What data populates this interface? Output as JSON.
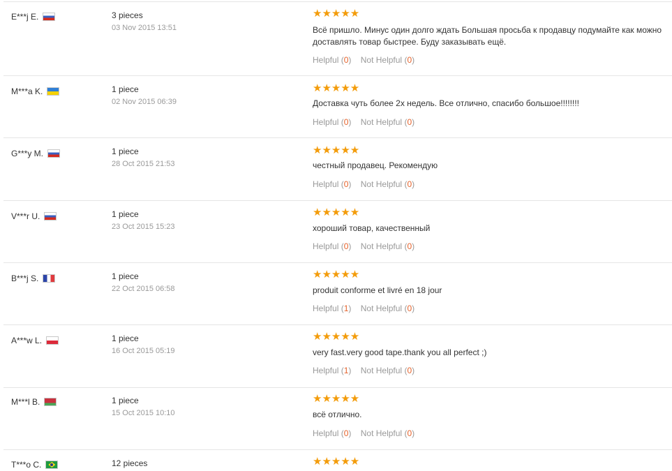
{
  "colors": {
    "star": "#f39c0b",
    "vote_count": "#e5622a",
    "meta": "#999999",
    "separator": "#e5e5e5"
  },
  "labels": {
    "helpful": "Helpful",
    "not_helpful": "Not Helpful"
  },
  "reviews": [
    {
      "buyer": "E***j E.",
      "flag": "russia-flag",
      "quantity": "3 pieces",
      "date": "03 Nov 2015 13:51",
      "rating": 5,
      "stars": "★★★★★",
      "comment": "Всё пришло. Минус один долго ждать Большая просьба к продавцу подумайте как можно доставлять товар быстрее. Буду заказывать ещё.",
      "helpful": "0",
      "not_helpful": "0"
    },
    {
      "buyer": "M***a K.",
      "flag": "ukraine-flag",
      "quantity": "1 piece",
      "date": "02 Nov 2015 06:39",
      "rating": 5,
      "stars": "★★★★★",
      "comment": "Доставка чуть более 2х недель. Все отлично, спасибо большое!!!!!!!!",
      "helpful": "0",
      "not_helpful": "0"
    },
    {
      "buyer": "G***y M.",
      "flag": "russia-flag",
      "quantity": "1 piece",
      "date": "28 Oct 2015 21:53",
      "rating": 5,
      "stars": "★★★★★",
      "comment": "честный продавец. Рекомендую",
      "helpful": "0",
      "not_helpful": "0"
    },
    {
      "buyer": "V***r U.",
      "flag": "russia-flag",
      "quantity": "1 piece",
      "date": "23 Oct 2015 15:23",
      "rating": 5,
      "stars": "★★★★★",
      "comment": "хороший товар, качественный",
      "helpful": "0",
      "not_helpful": "0"
    },
    {
      "buyer": "B***j S.",
      "flag": "france-flag",
      "quantity": "1 piece",
      "date": "22 Oct 2015 06:58",
      "rating": 5,
      "stars": "★★★★★",
      "comment": "produit conforme et livré en 18 jour",
      "helpful": "1",
      "not_helpful": "0"
    },
    {
      "buyer": "A***w L.",
      "flag": "poland-flag",
      "quantity": "1 piece",
      "date": "16 Oct 2015 05:19",
      "rating": 5,
      "stars": "★★★★★",
      "comment": "very fast.very good tape.thank you all perfect ;)",
      "helpful": "1",
      "not_helpful": "0"
    },
    {
      "buyer": "M***l B.",
      "flag": "belarus-flag",
      "quantity": "1 piece",
      "date": "15 Oct 2015 10:10",
      "rating": 5,
      "stars": "★★★★★",
      "comment": "всё отлично.",
      "helpful": "0",
      "not_helpful": "0"
    },
    {
      "buyer": "T***o C.",
      "flag": "brazil-flag",
      "quantity": "12 pieces",
      "rating": 5,
      "stars": "★★★★★"
    }
  ]
}
